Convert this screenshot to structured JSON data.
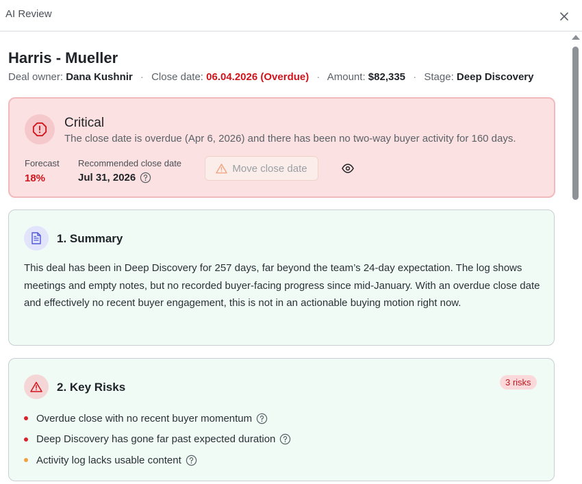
{
  "window": {
    "title": "AI Review"
  },
  "deal": {
    "name": "Harris - Mueller",
    "owner_label": "Deal owner:",
    "owner": "Dana Kushnir",
    "close_label": "Close date:",
    "close_date": "06.04.2026 (Overdue)",
    "amount_label": "Amount:",
    "amount": "$82,335",
    "stage_label": "Stage:",
    "stage": "Deep Discovery",
    "separator": "·"
  },
  "critical": {
    "title": "Critical",
    "description": "The close date is overdue (Apr 6, 2026) and there has been no two-way buyer activity for 160 days.",
    "forecast_label": "Forecast",
    "forecast_value": "18%",
    "recommended_label": "Recommended close date",
    "recommended_value": "Jul 31, 2026",
    "move_button": "Move close date"
  },
  "summary": {
    "title": "1. Summary",
    "text": "This deal has been in Deep Discovery for 257 days, far beyond the team’s 24-day expectation. The log shows meetings and empty notes, but no recorded buyer-facing progress since mid-January. With an overdue close date and effectively no recent buyer engagement, this is not in an actionable buying motion right now."
  },
  "risks": {
    "title": "2. Key Risks",
    "badge": "3 risks",
    "items": [
      {
        "label": "Overdue close with no recent buyer momentum",
        "color": "#d9232b"
      },
      {
        "label": "Deep Discovery has gone far past expected duration",
        "color": "#d9232b"
      },
      {
        "label": "Activity log lacks usable content",
        "color": "#f0a23e"
      }
    ]
  },
  "colors": {
    "critical_bg": "#fbe1e1",
    "critical_border": "#f2b9bb",
    "card_bg": "#f0fbf6",
    "danger": "#d0141c",
    "warning": "#f0a23e"
  },
  "icons": {
    "close": "close-icon",
    "critical": "octagon-alert-icon",
    "help": "question-circle-icon",
    "warning": "warning-triangle-icon",
    "eye": "eye-icon",
    "summary": "document-icon",
    "risks": "warning-triangle-icon"
  }
}
